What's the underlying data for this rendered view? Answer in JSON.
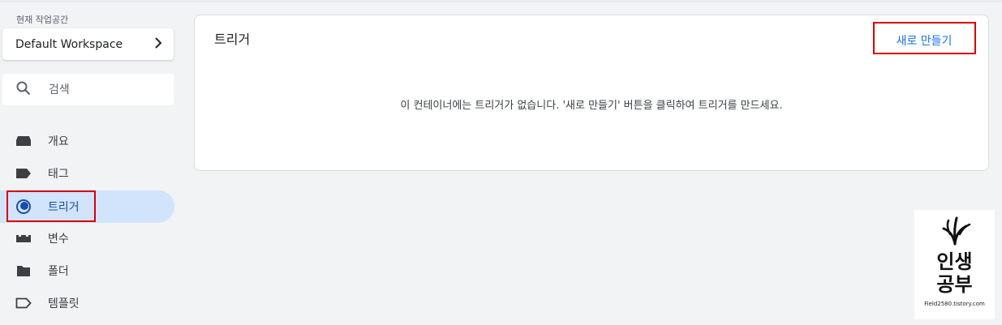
{
  "sidebar": {
    "workspace_caption": "현재 작업공간",
    "workspace_name": "Default Workspace",
    "search_placeholder": "검색",
    "items": [
      {
        "label": "개요"
      },
      {
        "label": "태그"
      },
      {
        "label": "트리거"
      },
      {
        "label": "변수"
      },
      {
        "label": "폴더"
      },
      {
        "label": "템플릿"
      }
    ],
    "active_item": "트리거"
  },
  "main": {
    "title": "트리거",
    "new_button_label": "새로 만들기",
    "empty_message": "이 컨테이너에는 트리거가 없습니다. '새로 만들기' 버튼을 클릭하여 트리거를 만드세요."
  },
  "watermark": {
    "line1": "인생",
    "line2": "공부",
    "url": "Field2580.tistory.com"
  },
  "colors": {
    "accent": "#1a73e8",
    "active_bg": "#d2e3fc",
    "highlight": "#d50000"
  }
}
